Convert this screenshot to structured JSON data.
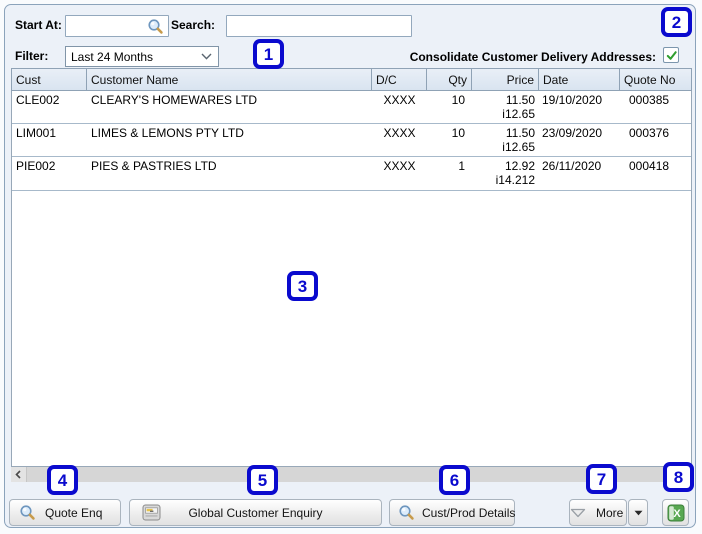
{
  "toolbar": {
    "start_at_label": "Start At:",
    "start_at_value": "",
    "search_label": "Search:",
    "search_value": "",
    "filter_label": "Filter:",
    "filter_value": "Last 24 Months",
    "consolidate_label": "Consolidate Customer Delivery Addresses:",
    "consolidate_checked": true
  },
  "table": {
    "columns": [
      "Cust",
      "Customer Name",
      "D/C",
      "Qty",
      "Price",
      "Date",
      "Quote No"
    ],
    "rows": [
      {
        "cust": "CLE002",
        "name": "CLEARY'S HOMEWARES LTD",
        "dc": "XXXX",
        "qty": "10",
        "price": "11.50",
        "price_i": "i12.65",
        "date": "19/10/2020",
        "quote_no": "000385"
      },
      {
        "cust": "LIM001",
        "name": "LIMES & LEMONS PTY LTD",
        "dc": "XXXX",
        "qty": "10",
        "price": "11.50",
        "price_i": "i12.65",
        "date": "23/09/2020",
        "quote_no": "000376"
      },
      {
        "cust": "PIE002",
        "name": "PIES & PASTRIES LTD",
        "dc": "XXXX",
        "qty": "1",
        "price": "12.92",
        "price_i": "i14.212",
        "date": "26/11/2020",
        "quote_no": "000418"
      }
    ]
  },
  "footer": {
    "quote_enq_label": "Quote Enq",
    "global_enquiry_label": "Global Customer Enquiry",
    "cust_prod_label": "Cust/Prod Details",
    "more_label": "More"
  },
  "badges": [
    "1",
    "2",
    "3",
    "4",
    "5",
    "6",
    "7",
    "8"
  ],
  "icons": {
    "magnifier": "magnifying-glass",
    "global_enquiry": "card-file-drawer",
    "more": "filter-funnel",
    "more_split": "dropdown-arrow",
    "export_excel": "excel-spreadsheet-x",
    "combo_chevron": "chevron-down",
    "checkbox_check": "green-checkmark",
    "scroll_left": "left-arrow"
  },
  "colors": {
    "badge_blue": "#0a0ace",
    "panel_border": "#8ba3bb",
    "panel_bg": "#ecf1f8",
    "header_bg_top": "#e9eff7",
    "header_bg_bottom": "#d9e4f0",
    "row_separator": "#a7b9ca",
    "check_green": "#2f9e2f",
    "excel_green": "#58a851",
    "magnifier_gold": "#c79b4b"
  }
}
